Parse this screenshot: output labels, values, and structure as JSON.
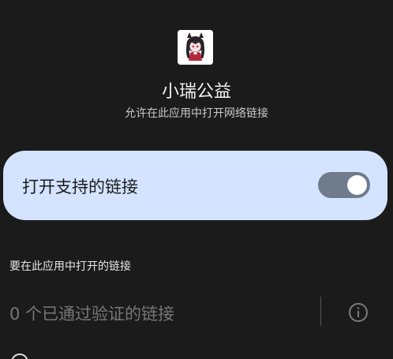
{
  "app": {
    "name": "小瑞公益",
    "subtitle": "允许在此应用中打开网络链接",
    "icon": "anime-girl-avatar-icon"
  },
  "toggle": {
    "label": "打开支持的链接",
    "state": "on"
  },
  "links_section": {
    "header": "要在此应用中打开的链接",
    "verified_links_text": "0 个已通过验证的链接",
    "info_icon": "info-icon"
  },
  "colors": {
    "background": "#1b1b1b",
    "card": "#d4e3ff",
    "switch_track": "#707b8b",
    "muted_text": "#767676"
  }
}
